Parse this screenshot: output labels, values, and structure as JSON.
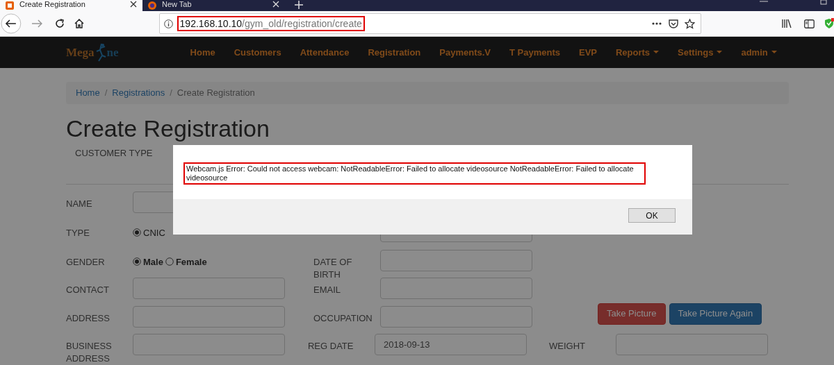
{
  "browser": {
    "tabs": [
      {
        "title": "Create Registration",
        "selected": true
      },
      {
        "title": "New Tab",
        "selected": false
      }
    ],
    "url": {
      "host": "192.168.10.10",
      "path": "/gym_old/registration/create",
      "highlighted": true
    }
  },
  "navbar": {
    "brand": {
      "left": "Mega",
      "right": "ne"
    },
    "items": [
      {
        "label": "Home",
        "dropdown": false
      },
      {
        "label": "Customers",
        "dropdown": false
      },
      {
        "label": "Attendance",
        "dropdown": false
      },
      {
        "label": "Registration",
        "dropdown": false
      },
      {
        "label": "Payments.V",
        "dropdown": false
      },
      {
        "label": "T Payments",
        "dropdown": false
      },
      {
        "label": "EVP",
        "dropdown": false
      },
      {
        "label": "Reports",
        "dropdown": true
      },
      {
        "label": "Settings",
        "dropdown": true
      },
      {
        "label": "admin",
        "dropdown": true
      }
    ]
  },
  "breadcrumb_separator": "/",
  "breadcrumb": [
    {
      "label": "Home",
      "current": false
    },
    {
      "label": "Registrations",
      "current": false
    },
    {
      "label": "Create Registration",
      "current": true
    }
  ],
  "title": "Create Registration",
  "customer_type_label": "CUSTOMER TYPE",
  "form": {
    "rows": [
      {
        "left": {
          "label": "NAME",
          "kind": "input"
        }
      },
      {
        "left": {
          "label": "TYPE",
          "kind": "radio",
          "bold": false,
          "options": [
            {
              "label": "CNIC",
              "selected": true
            }
          ]
        },
        "right": {
          "kind": "input"
        }
      },
      {
        "left": {
          "label": "GENDER",
          "kind": "radio",
          "bold": true,
          "options": [
            {
              "label": "Male",
              "selected": true
            },
            {
              "label": "Female",
              "selected": false
            }
          ]
        },
        "right": {
          "label": "DATE OF BIRTH",
          "kind": "input"
        }
      },
      {
        "left": {
          "label": "CONTACT",
          "kind": "input"
        },
        "right": {
          "label": "EMAIL",
          "kind": "input"
        }
      },
      {
        "left": {
          "label": "ADDRESS",
          "kind": "input"
        },
        "right": {
          "label": "OCCUPATION",
          "kind": "input"
        },
        "extra": {
          "kind": "buttons",
          "buttons": [
            {
              "label": "Take Picture"
            },
            {
              "label": "Take Picture Again"
            }
          ]
        }
      },
      {
        "left": {
          "label": "BUSINESS ADDRESS",
          "kind": "input"
        },
        "right": {
          "label": "REG DATE",
          "kind": "input",
          "value": "2018-09-13"
        },
        "extra": {
          "kind": "field",
          "label": "WEIGHT"
        }
      }
    ]
  },
  "dialog": {
    "message": "Webcam.js Error: Could not access webcam: NotReadableError: Failed to allocate videosource NotReadableError: Failed to allocate videosource",
    "highlighted": true,
    "button": "OK"
  }
}
